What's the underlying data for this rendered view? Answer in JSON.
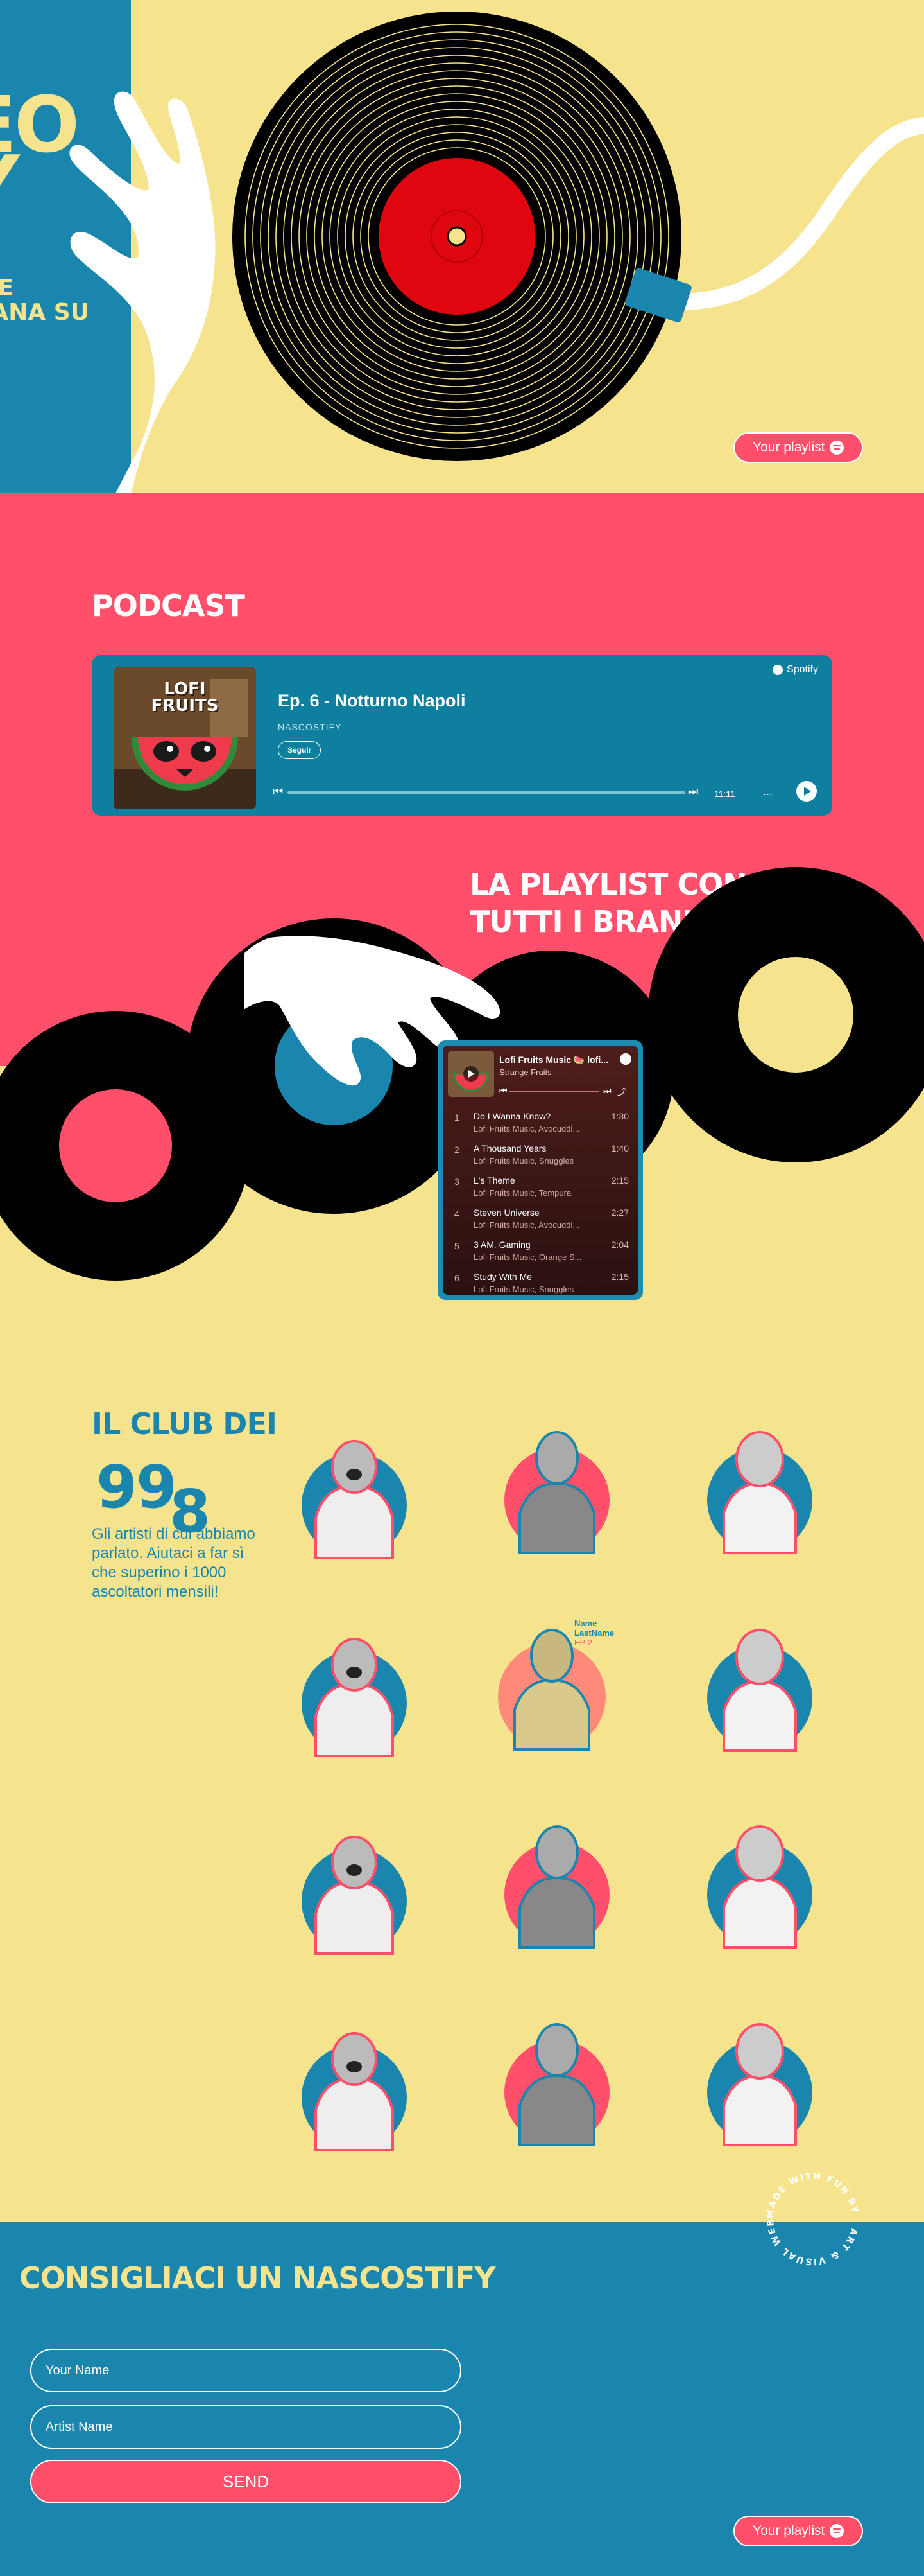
{
  "hero": {
    "big_text": "EO\nY",
    "sub_text": "TE\nIANA SU",
    "playlist_button": "Your playlist"
  },
  "podcast": {
    "section_title": "PODCAST",
    "cover_text": "LOFI\nFRUITS",
    "episode": "Ep. 6 - Notturno Napoli",
    "show": "NASCOSTIFY",
    "follow": "Seguir",
    "brand": "Spotify",
    "time": "11:11",
    "more": "..."
  },
  "playlist": {
    "section_title_line1": "LA PLAYLIST CON",
    "section_title_line2": "TUTTI I BRANI",
    "name": "Lofi Fruits Music 🍉 lofi...",
    "artist": "Strange Fruits",
    "tracks": [
      {
        "num": "1",
        "title": "Do I Wanna Know?",
        "artist": "Lofi Fruits Music, Avocuddl...",
        "duration": "1:30"
      },
      {
        "num": "2",
        "title": "A Thousand Years",
        "artist": "Lofi Fruits Music, Snuggles",
        "duration": "1:40"
      },
      {
        "num": "3",
        "title": "L's Theme",
        "artist": "Lofi Fruits Music, Tempura",
        "duration": "2:15"
      },
      {
        "num": "4",
        "title": "Steven Universe",
        "artist": "Lofi Fruits Music, Avocuddl...",
        "duration": "2:27"
      },
      {
        "num": "5",
        "title": "3 AM. Gaming",
        "artist": "Lofi Fruits Music, Orange S...",
        "duration": "2:04"
      },
      {
        "num": "6",
        "title": "Study With Me",
        "artist": "Lofi Fruits Music, Snuggles",
        "duration": "2:15"
      }
    ]
  },
  "club": {
    "title": "IL CLUB DEI",
    "number_main": "99",
    "number_small": "8",
    "description": "Gli artisti di cui abbiamo parlato. Aiutaci a far sì che superino i 1000 ascoltatori mensili!",
    "hover_name": "Name",
    "hover_lastname": "LastName",
    "hover_ep": "EP 2"
  },
  "form": {
    "title": "CONSIGLIACI UN NASCOSTIFY",
    "name_placeholder": "Your Name",
    "artist_placeholder": "Artist Name",
    "send": "SEND",
    "playlist_button": "Your playlist",
    "badge_text": "MADE WITH FUN BY · ART & VISUAL WEBSITE ·"
  },
  "colors": {
    "yellow": "#f5e38e",
    "blue": "#1a86ad",
    "pink": "#ff4f6a",
    "black": "#000000"
  }
}
